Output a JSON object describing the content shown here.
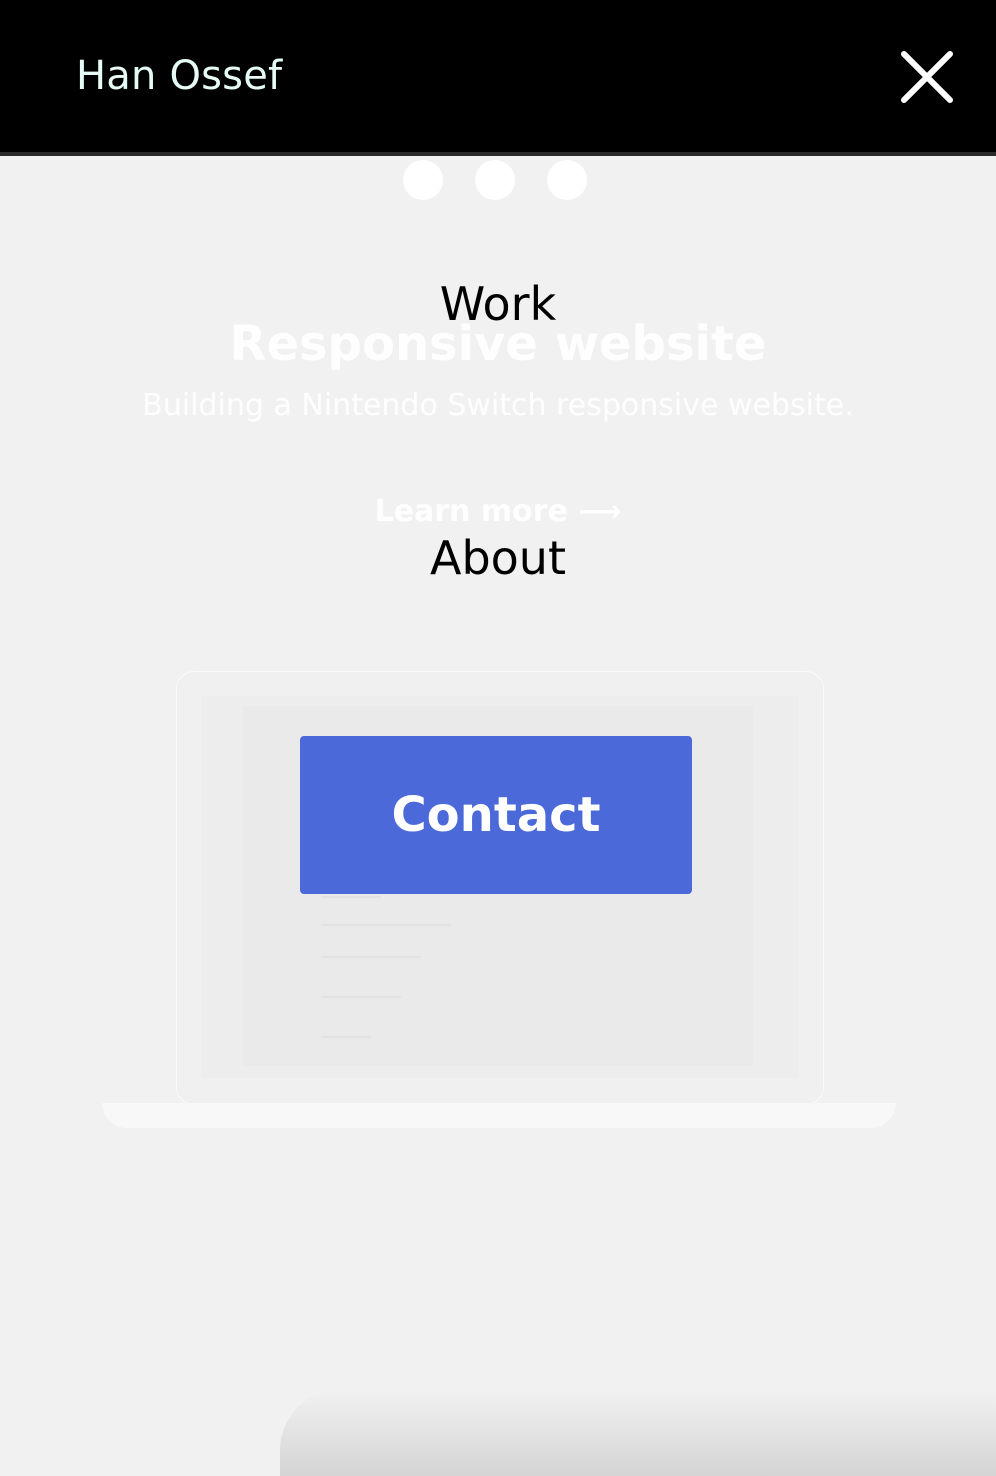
{
  "header": {
    "brand": "Han Ossef",
    "close_icon": "close-icon"
  },
  "carousel": {
    "dots": 3
  },
  "project": {
    "title": "Responsive website",
    "description": "Building a Nintendo Switch responsive website.",
    "link": "Learn more ⟶"
  },
  "menu": {
    "work": "Work",
    "about": "About",
    "contact": "Contact"
  },
  "colors": {
    "header_bg": "#000000",
    "brand_text": "#e6fbf5",
    "page_bg": "#f1f1f1",
    "contact_bg": "#4b69d8"
  }
}
